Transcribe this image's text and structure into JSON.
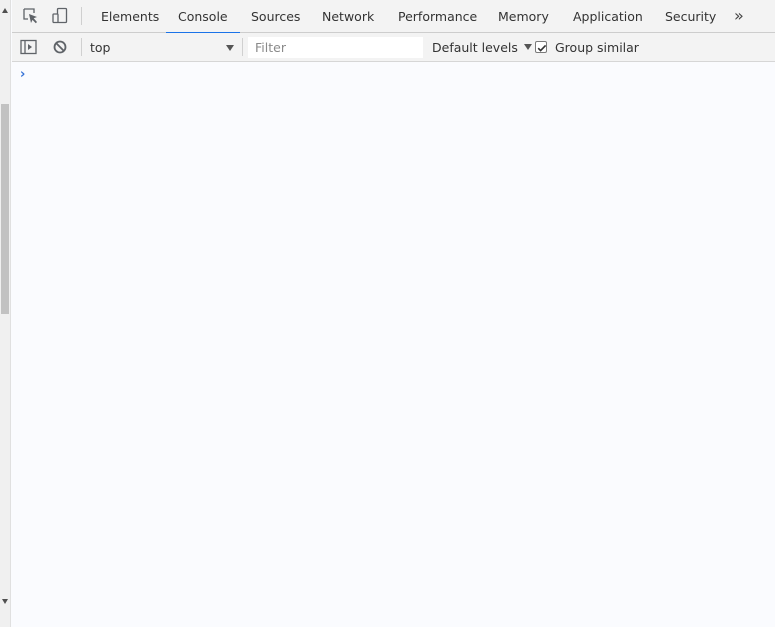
{
  "tabs": [
    {
      "label": "Elements",
      "active": false
    },
    {
      "label": "Console",
      "active": true
    },
    {
      "label": "Sources",
      "active": false
    },
    {
      "label": "Network",
      "active": false
    },
    {
      "label": "Performance",
      "active": false
    },
    {
      "label": "Memory",
      "active": false
    },
    {
      "label": "Application",
      "active": false
    },
    {
      "label": "Security",
      "active": false
    }
  ],
  "more_tabs_glyph": "»",
  "toolbar": {
    "context": "top",
    "filter_placeholder": "Filter",
    "filter_value": "",
    "levels": "Default levels",
    "group_similar_label": "Group similar",
    "group_similar_checked": true
  },
  "console": {
    "prompt": "›"
  },
  "icons": {
    "inspect": "inspect-element-icon",
    "device": "device-toolbar-icon",
    "sidebar": "console-sidebar-icon",
    "clear": "clear-console-icon"
  },
  "colors": {
    "accent": "#1a73e8",
    "prompt": "#3572d6",
    "toolbar_bg": "#f3f3f3",
    "console_bg": "#fafbfe"
  }
}
